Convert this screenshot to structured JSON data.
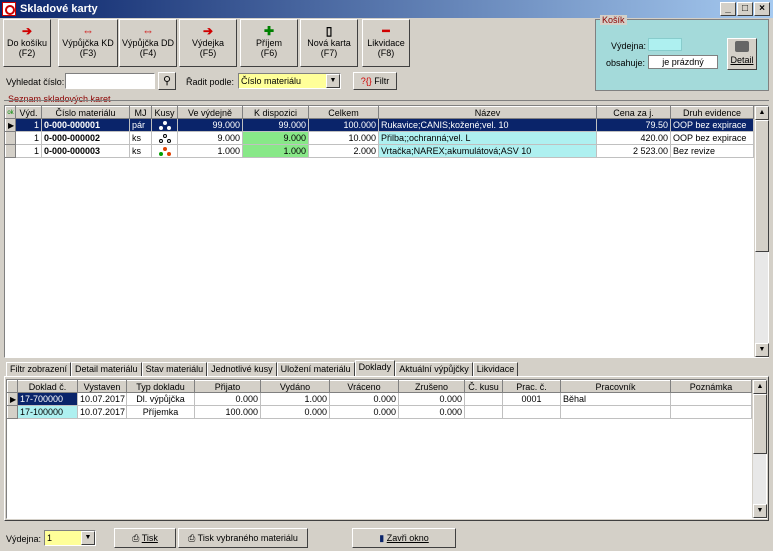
{
  "window": {
    "title": "Skladové karty",
    "min": "_",
    "max": "□",
    "close": "×"
  },
  "toolbar": [
    {
      "icon": "➔",
      "label1": "Do košíku",
      "label2": "(F2)"
    },
    {
      "icon": "⇔",
      "label1": "Výpůjčka KD",
      "label2": "(F3)"
    },
    {
      "icon": "⇔",
      "label1": "Výpůjčka DD",
      "label2": "(F4)"
    },
    {
      "icon": "➔",
      "label1": "Výdejka",
      "label2": "(F5)"
    },
    {
      "icon": "✚",
      "label1": "Příjem",
      "label2": "(F6)"
    },
    {
      "icon": "▯",
      "label1": "Nová karta",
      "label2": "(F7)"
    },
    {
      "icon": "━",
      "label1": "Likvidace",
      "label2": "(F8)"
    }
  ],
  "kosik": {
    "title": "Košík",
    "vydejna_label": "Výdejna:",
    "vydejna_value": "",
    "obsahuje_label": "obsahuje:",
    "obsahuje_value": "je prázdný",
    "detail": "Detail"
  },
  "search": {
    "label": "Vyhledat číslo:",
    "value": "",
    "radit_label": "Řadit podle:",
    "radit_value": "Číslo materiálu",
    "filtr": "Filtr"
  },
  "section": "Seznam skladových karet",
  "cards": {
    "headers": [
      "",
      "Výd.",
      "Číslo materiálu",
      "MJ",
      "Kusy",
      "Ve výdejně",
      "K dispozici",
      "Celkem",
      "Název",
      "Cena za j.",
      "Druh evidence"
    ],
    "corner": "ok",
    "rows": [
      {
        "vyd": "1",
        "cislo": "0-000-000001",
        "mj": "pár",
        "ve": "99.000",
        "k": "99.000",
        "celkem": "100.000",
        "nazev": "Rukavice;CANIS;kožené;vel. 10",
        "cena": "79.50",
        "druh": "OOP bez expirace"
      },
      {
        "vyd": "1",
        "cislo": "0-000-000002",
        "mj": "ks",
        "ve": "9.000",
        "k": "9.000",
        "celkem": "10.000",
        "nazev": "Přilba;;ochranná;vel. L",
        "cena": "420.00",
        "druh": "OOP bez expirace"
      },
      {
        "vyd": "1",
        "cislo": "0-000-000003",
        "mj": "ks",
        "ve": "1.000",
        "k": "1.000",
        "celkem": "2.000",
        "nazev": "Vrtačka;NAREX;akumulátová;ASV 10",
        "cena": "2 523.00",
        "druh": "Bez revize"
      }
    ]
  },
  "tabs": [
    "Filtr zobrazení",
    "Detail materiálu",
    "Stav materiálu",
    "Jednotlivé kusy",
    "Uložení materiálu",
    "Doklady",
    "Aktuální výpůjčky",
    "Likvidace"
  ],
  "docs": {
    "headers": [
      "",
      "Doklad č.",
      "Vystaven",
      "Typ dokladu",
      "Přijato",
      "Vydáno",
      "Vráceno",
      "Zrušeno",
      "Č. kusu",
      "Prac. č.",
      "Pracovník",
      "Poznámka"
    ],
    "rows": [
      {
        "doklad": "17-700000",
        "vystaven": "10.07.2017",
        "typ": "Dl. výpůjčka",
        "prijato": "0.000",
        "vydano": "1.000",
        "vraceno": "0.000",
        "zruseno": "0.000",
        "kus": "",
        "prac": "0001",
        "pracovnik": "Běhal",
        "pozn": ""
      },
      {
        "doklad": "17-100000",
        "vystaven": "10.07.2017",
        "typ": "Příjemka",
        "prijato": "100.000",
        "vydano": "0.000",
        "vraceno": "0.000",
        "zruseno": "0.000",
        "kus": "",
        "prac": "",
        "pracovnik": "",
        "pozn": ""
      }
    ]
  },
  "footer": {
    "vydejna_label": "Výdejna:",
    "vydejna_value": "1",
    "tisk": "Tisk",
    "tisk_vybr": "Tisk vybraného materiálu",
    "zavri": "Zavři okno"
  }
}
